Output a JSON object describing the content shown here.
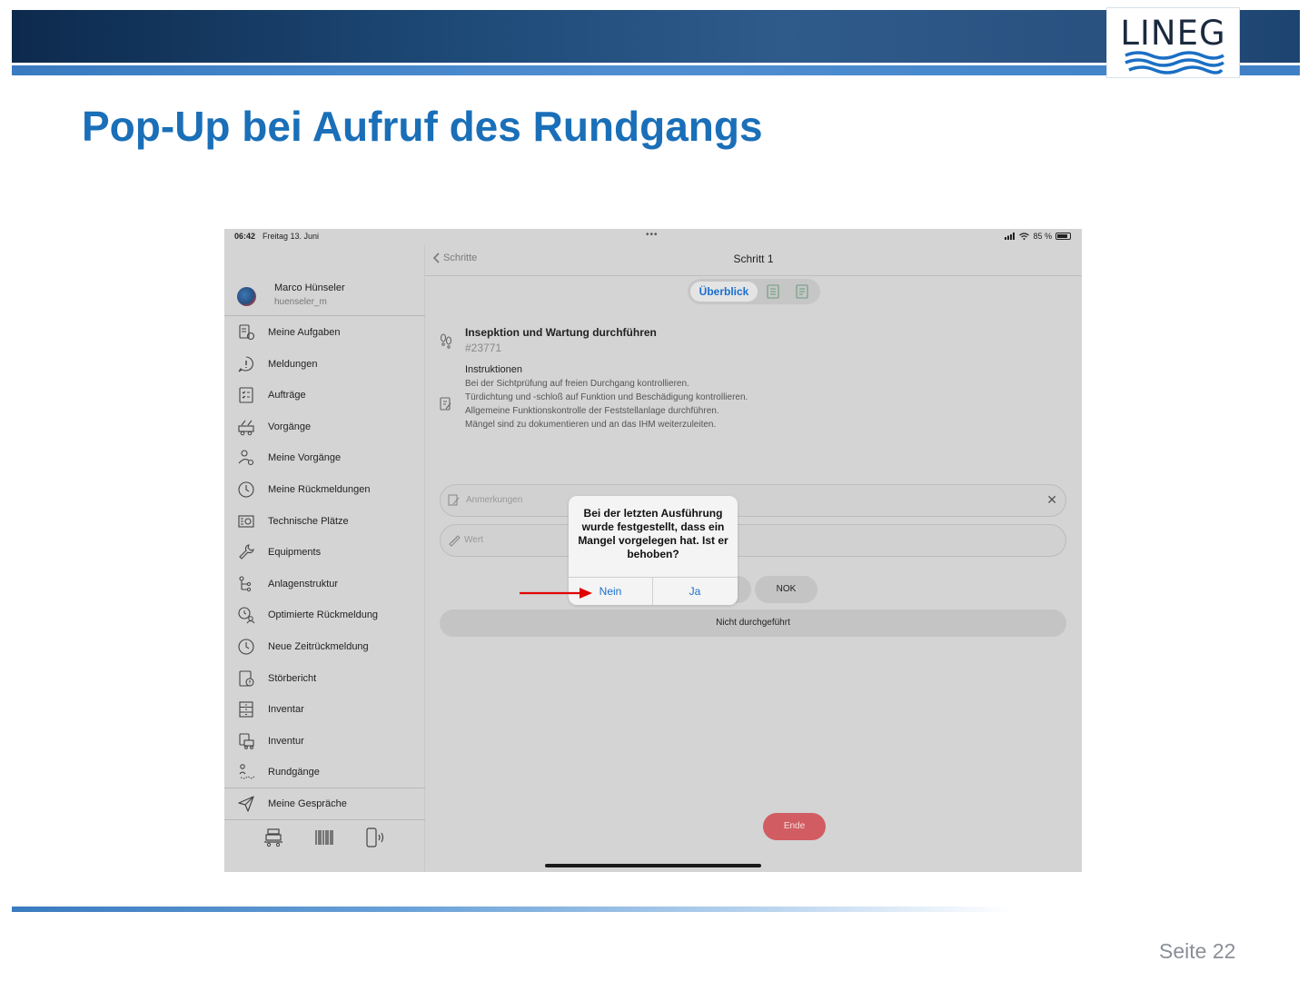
{
  "slide": {
    "title": "Pop-Up bei Aufruf des Rundgangs",
    "page_label": "Seite 22",
    "logo_text": "LINEG",
    "brand_color": "#1a6fb8"
  },
  "status_bar": {
    "time": "06:42",
    "date": "Freitag 13. Juni",
    "battery": "85 %"
  },
  "user": {
    "name": "Marco Hünseler",
    "id": "huenseler_m"
  },
  "nav": [
    {
      "label": "Meine Aufgaben",
      "icon": "tasks-icon"
    },
    {
      "label": "Meldungen",
      "icon": "speech-alert-icon"
    },
    {
      "label": "Aufträge",
      "icon": "checklist-icon"
    },
    {
      "label": "Vorgänge",
      "icon": "vehicle-tools-icon"
    },
    {
      "label": "Meine Vorgänge",
      "icon": "user-gear-icon"
    },
    {
      "label": "Meine Rückmeldungen",
      "icon": "clock-icon"
    },
    {
      "label": "Technische Plätze",
      "icon": "machine-icon"
    },
    {
      "label": "Equipments",
      "icon": "wrench-icon"
    },
    {
      "label": "Anlagenstruktur",
      "icon": "tree-structure-icon"
    },
    {
      "label": "Optimierte Rückmeldung",
      "icon": "clock-user-icon"
    },
    {
      "label": "Neue Zeitrückmeldung",
      "icon": "clock-icon"
    },
    {
      "label": "Störbericht",
      "icon": "report-warning-icon"
    },
    {
      "label": "Inventar",
      "icon": "cabinet-icon"
    },
    {
      "label": "Inventur",
      "icon": "inventory-icon"
    },
    {
      "label": "Rundgänge",
      "icon": "route-walk-icon"
    }
  ],
  "nav_extra": {
    "label": "Meine Gespräche",
    "icon": "send-icon"
  },
  "main": {
    "back_label": "Schritte",
    "title": "Schritt 1",
    "segment_active": "Überblick",
    "task_title": "Insepktion und Wartung durchführen",
    "task_id": "#23771",
    "instructions_title": "Instruktionen",
    "instructions": [
      "Bei der Sichtprüfung auf freien Durchgang kontrollieren.",
      "Türdichtung und -schloß auf Funktion und Beschädigung kontrollieren.",
      "Allgemeine Funktionskontrolle der Feststellanlage durchführen.",
      "Mängel sind zu dokumentieren und an das IHM weiterzuleiten."
    ],
    "remarks_placeholder": "Anmerkungen",
    "value_placeholder": "Wert",
    "nok_label": "NOK",
    "not_done_label": "Nicht durchgeführt",
    "end_label": "Ende"
  },
  "dialog": {
    "message": "Bei der letzten Ausführung wurde festgestellt, dass ein Mangel vorgelegen hat. Ist er behoben?",
    "no_label": "Nein",
    "yes_label": "Ja"
  },
  "colors": {
    "accent": "#1a6fd0",
    "end_button": "#d15d62",
    "arrow": "#e00000"
  }
}
